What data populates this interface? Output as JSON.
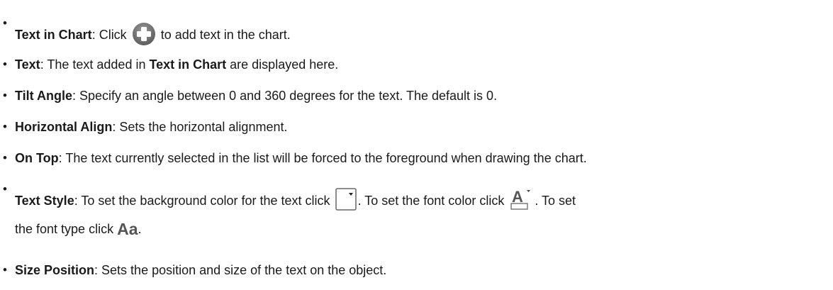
{
  "items": [
    {
      "term": "Text in Chart",
      "desc_a": ": Click ",
      "desc_b": " to add text in the chart."
    },
    {
      "term": "Text",
      "desc_a": ": The text added in ",
      "term2": "Text in Chart",
      "desc_b": " are displayed here."
    },
    {
      "term": "Tilt Angle",
      "desc": ": Specify an angle between 0 and 360 degrees for the text. The default is 0."
    },
    {
      "term": "Horizontal Align",
      "desc": ": Sets the horizontal alignment."
    },
    {
      "term": "On Top",
      "desc": ": The text currently selected in the list will be forced to the foreground when drawing the chart."
    },
    {
      "term": "Text Style",
      "desc_a": ": To set the background color for the text click ",
      "desc_b": ". To set the font color click ",
      "desc_c": ". To set",
      "desc_d": "the font type click ",
      "aa_glyph": "Aa",
      "desc_e": "."
    },
    {
      "term": "Size Position",
      "desc": ": Sets the position and size of the text on the object."
    }
  ],
  "colors": {
    "text": "#1a1a1a",
    "icon_gray": "#8a8a8a"
  },
  "icons": [
    "add-circle-icon",
    "background-color-dropdown-icon",
    "font-color-icon",
    "font-type-icon"
  ]
}
